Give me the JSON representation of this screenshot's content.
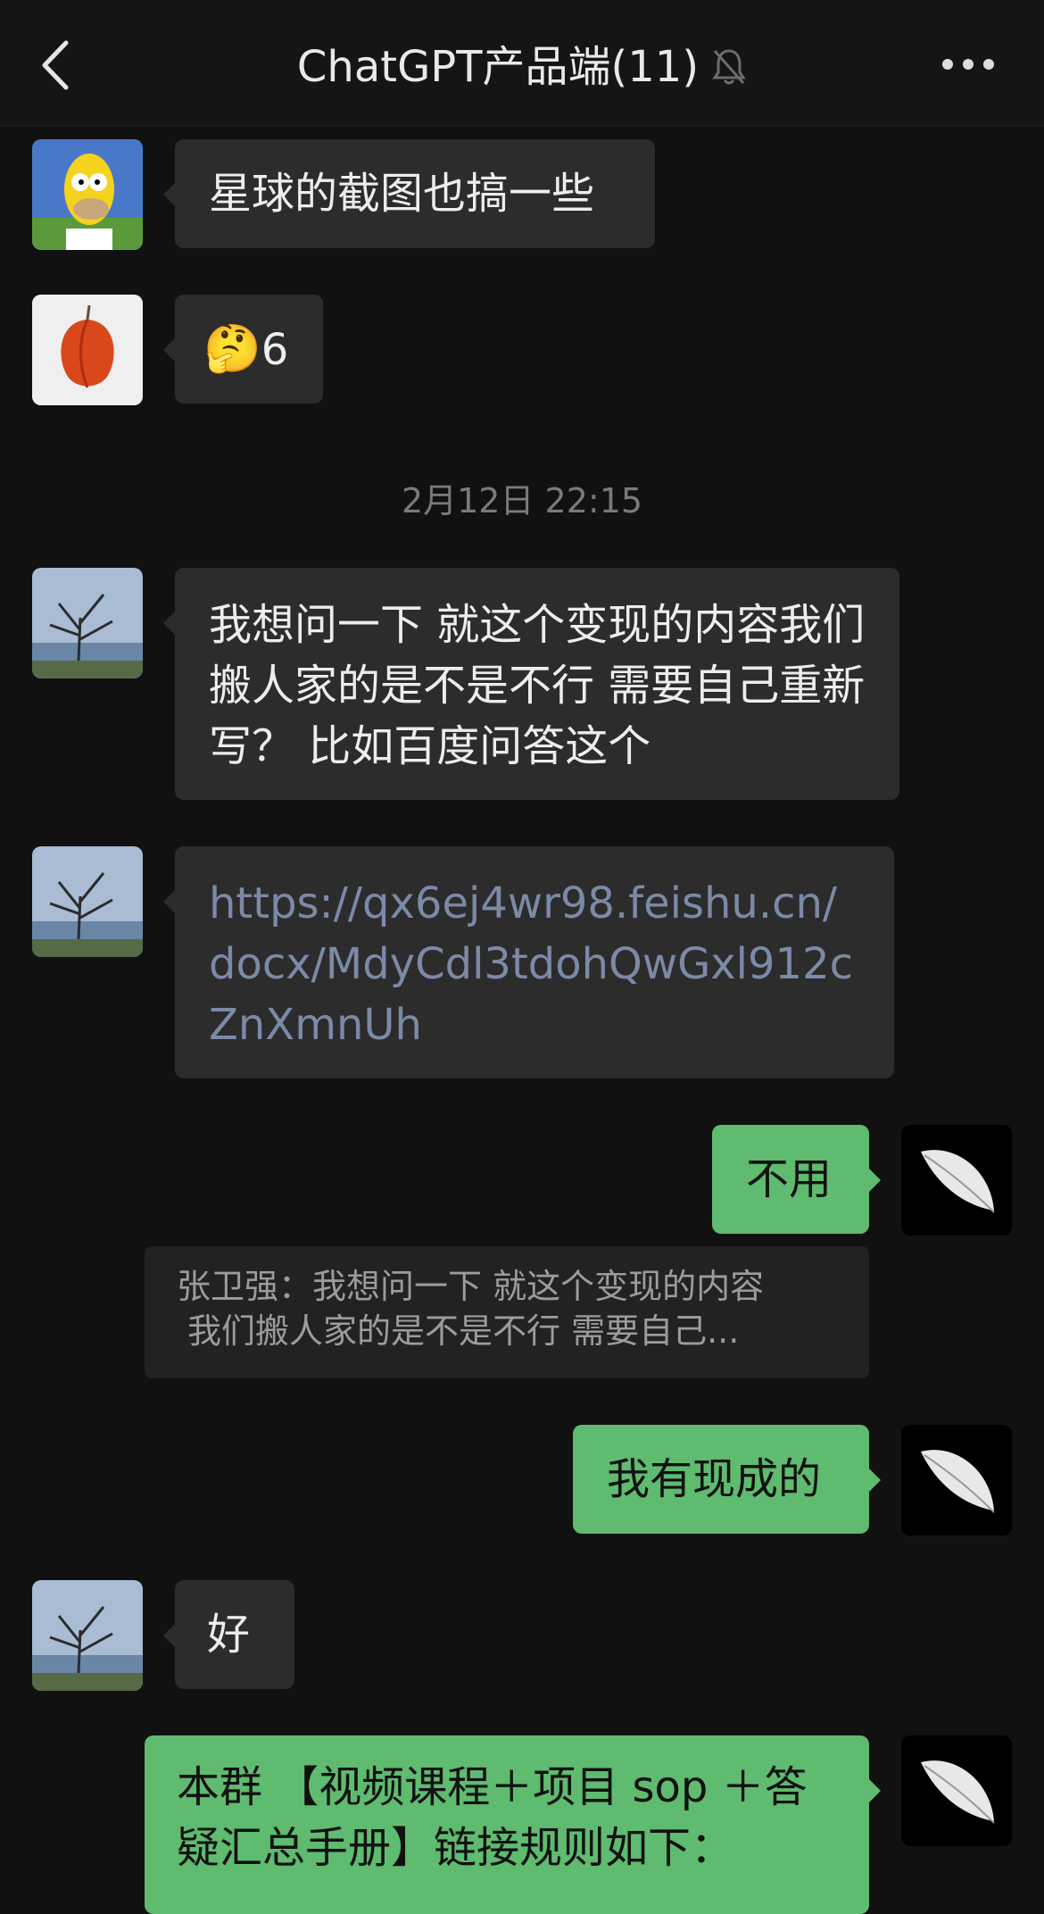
{
  "header": {
    "title": "ChatGPT产品端(11)",
    "back_icon": "chevron-left-icon",
    "mute_icon": "bell-slash-icon",
    "more_icon": "more-dots-icon"
  },
  "messages": [
    {
      "text": "星球的截图也搞一些"
    },
    {
      "emoji": "🤔",
      "text": "6"
    },
    {
      "text": "我想问一下 就这个变现的内容我们搬人家的是不是不行 需要自己重新写？ 比如百度问答这个"
    },
    {
      "text": "https://qx6ej4wr98.feishu.cn/docx/MdyCdl3tdohQwGxl912cZnXmnUh"
    },
    {
      "text": "不用"
    },
    {
      "text": "我有现成的"
    },
    {
      "text": "好"
    },
    {
      "text": "本群 【视频课程＋项目 sop ＋答疑汇总手册】链接规则如下："
    }
  ],
  "timestamp": "2月12日 22:15",
  "quote": {
    "line1": "张卫强：我想问一下 就这个变现的内容",
    "line2": "我们搬人家的是不是不行 需要自己..."
  },
  "colors": {
    "background": "#111111",
    "bubble": "#2c2c2c",
    "own_bubble": "#5ebb6f",
    "link": "#7b8aa6"
  }
}
